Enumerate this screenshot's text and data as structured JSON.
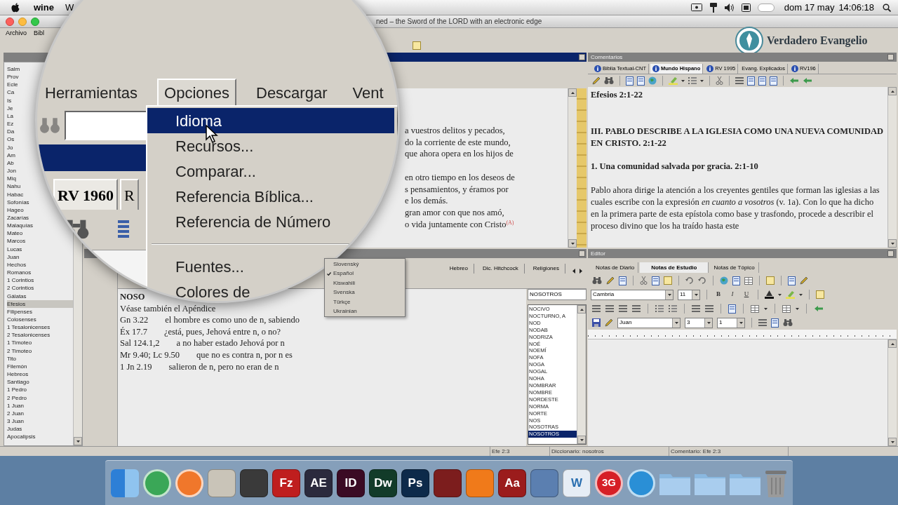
{
  "menubar": {
    "app": "wine",
    "menu_fragment": "W",
    "date": "dom 17 may",
    "time": "14:06:18"
  },
  "window": {
    "title": "ned – the Sword of the LORD with an electronic edge",
    "menu": [
      "Archivo",
      "Bibl"
    ],
    "logo": "Verdadero Evangelio"
  },
  "books": [
    {
      "label": "Salm",
      "selected": false
    },
    {
      "label": "Prov",
      "selected": false
    },
    {
      "label": "Ecle",
      "selected": false
    },
    {
      "label": "Ca",
      "selected": false
    },
    {
      "label": "Is",
      "selected": false
    },
    {
      "label": "Je",
      "selected": false
    },
    {
      "label": "La",
      "selected": false
    },
    {
      "label": "Ez",
      "selected": false
    },
    {
      "label": "Da",
      "selected": false
    },
    {
      "label": "Os",
      "selected": false
    },
    {
      "label": "Jo",
      "selected": false
    },
    {
      "label": "Am",
      "selected": false
    },
    {
      "label": "Ab",
      "selected": false
    },
    {
      "label": "Jon",
      "selected": false
    },
    {
      "label": "Miq",
      "selected": false
    },
    {
      "label": "Nahu",
      "selected": false
    },
    {
      "label": "Habac",
      "selected": false
    },
    {
      "label": "Sofonías",
      "selected": false
    },
    {
      "label": "Hageo",
      "selected": false
    },
    {
      "label": "Zacarías",
      "selected": false
    },
    {
      "label": "Malaquías",
      "selected": false
    },
    {
      "label": "Mateo",
      "selected": false
    },
    {
      "label": "Marcos",
      "selected": false
    },
    {
      "label": "Lucas",
      "selected": false
    },
    {
      "label": "Juan",
      "selected": false
    },
    {
      "label": "Hechos",
      "selected": false
    },
    {
      "label": "Romanos",
      "selected": false
    },
    {
      "label": "1 Corintios",
      "selected": false
    },
    {
      "label": "2 Corintios",
      "selected": false
    },
    {
      "label": "Gálatas",
      "selected": false
    },
    {
      "label": "Efesios",
      "selected": true
    },
    {
      "label": "Filipenses",
      "selected": false
    },
    {
      "label": "Colosenses",
      "selected": false
    },
    {
      "label": "1 Tesalonicenses",
      "selected": false
    },
    {
      "label": "2 Tesalonicenses",
      "selected": false
    },
    {
      "label": "1 Timoteo",
      "selected": false
    },
    {
      "label": "2 Timoteo",
      "selected": false
    },
    {
      "label": "Tito",
      "selected": false
    },
    {
      "label": "Filemón",
      "selected": false
    },
    {
      "label": "Hebreos",
      "selected": false
    },
    {
      "label": "Santiago",
      "selected": false
    },
    {
      "label": "1 Pedro",
      "selected": false
    },
    {
      "label": "2 Pedro",
      "selected": false
    },
    {
      "label": "1 Juan",
      "selected": false
    },
    {
      "label": "2 Juan",
      "selected": false
    },
    {
      "label": "3 Juan",
      "selected": false
    },
    {
      "label": "Judas",
      "selected": false
    },
    {
      "label": "Apocalipsis",
      "selected": false
    }
  ],
  "bible_panel": {
    "paragraphs": [
      [
        "a vuestros delitos y pecados,",
        "do la corriente de este mundo,",
        "que ahora opera en los hijos de"
      ],
      [
        "en otro tiempo en los deseos de",
        "s pensamientos, y éramos por",
        "e los demás.",
        "gran amor con que nos amó,",
        "o vida juntamente con Cristo$^{(A)}$"
      ]
    ]
  },
  "dictionary": {
    "tabs": [
      {
        "label": "Hebreo",
        "selected": false
      },
      {
        "label": "Dic. Hitchcock",
        "selected": false
      },
      {
        "label": "Religiones",
        "selected": false
      }
    ],
    "heading": "NOSO",
    "see_also": "Véase también el Apéndice",
    "entries": [
      {
        "ref": "Gn 3.22",
        "text": "el hombre es como uno de n, sabiendo"
      },
      {
        "ref": "Éx 17.7",
        "text": "¿está, pues, Jehová entre n, o no?"
      },
      {
        "ref": "Sal 124.1,2",
        "text": "a no haber estado Jehová por n"
      },
      {
        "ref": "Mr 9.40; Lc 9.50",
        "text": "que no es contra n, por n es"
      },
      {
        "ref": "1 Jn 2.19",
        "text": "salieron de n, pero no eran de n"
      }
    ],
    "search": "NOSOTROS",
    "words": [
      {
        "label": "NOCIVO",
        "selected": false
      },
      {
        "label": "NOCTURNO, A",
        "selected": false
      },
      {
        "label": "NOD",
        "selected": false
      },
      {
        "label": "NODAB",
        "selected": false
      },
      {
        "label": "NODRIZA",
        "selected": false
      },
      {
        "label": "NOÉ",
        "selected": false
      },
      {
        "label": "NOEMÍ",
        "selected": false
      },
      {
        "label": "NOFA",
        "selected": false
      },
      {
        "label": "NOGA",
        "selected": false
      },
      {
        "label": "NOGAL",
        "selected": false
      },
      {
        "label": "NOHA",
        "selected": false
      },
      {
        "label": "NOMBRAR",
        "selected": false
      },
      {
        "label": "NOMBRE",
        "selected": false
      },
      {
        "label": "NORDESTE",
        "selected": false
      },
      {
        "label": "NORMA",
        "selected": false
      },
      {
        "label": "NORTE",
        "selected": false
      },
      {
        "label": "NOS",
        "selected": false
      },
      {
        "label": "NOSOTRAS",
        "selected": false
      },
      {
        "label": "NOSOTROS",
        "selected": true
      }
    ]
  },
  "commentary": {
    "header": "Comentarios",
    "tabs": [
      {
        "label": "Biblia Textual-CNT",
        "icon": true,
        "selected": false
      },
      {
        "label": "Mundo Hispano",
        "icon": true,
        "selected": true
      },
      {
        "label": "RV 1995",
        "icon": true,
        "selected": false
      },
      {
        "label": "Evang. Explicados",
        "icon": false,
        "selected": false
      },
      {
        "label": "RV196",
        "icon": true,
        "selected": false
      }
    ],
    "title": "Efesios 2:1-22",
    "heading": "III. PABLO DESCRIBE A LA IGLESIA COMO UNA NUEVA COMUNIDAD EN CRISTO. 2:1-22",
    "subheading": "1. Una comunidad salvada por gracia. 2:1-10",
    "paragraph": "Pablo ahora dirige la atención a los creyentes gentiles que forman las iglesias a las cuales escribe con la expresión *en cuanto a vosotros* (v. 1a). Con lo que ha dicho en la primera parte de esta epístola como base y trasfondo, procede a describir el proceso divino que los ha traído hasta este"
  },
  "editor": {
    "header": "Editor",
    "tabs": [
      {
        "label": "Notas de Diario",
        "selected": false
      },
      {
        "label": "Notas de Estudio",
        "selected": true
      },
      {
        "label": "Notas de Tópico",
        "selected": false
      }
    ],
    "font": "Cambria",
    "size": "11",
    "format_buttons": [
      "B",
      "I",
      "U"
    ],
    "style": "Juan",
    "field_2": "3",
    "field_3": "1"
  },
  "status_bar": [
    "Efe 2:3",
    "Diccionario: nosotros",
    "Comentario: Efe 2:3"
  ],
  "magnifier": {
    "menus": [
      {
        "label": "Herramientas",
        "selected": false
      },
      {
        "label": "Opciones",
        "selected": true
      },
      {
        "label": "Descargar",
        "selected": false
      },
      {
        "label": "Vent",
        "selected": false
      }
    ],
    "tabs": [
      {
        "label": "RV 1960",
        "selected": true
      },
      {
        "label": "R",
        "selected": false
      }
    ],
    "items": [
      {
        "kind": "item",
        "label": "Idioma",
        "selected": true
      },
      {
        "kind": "item",
        "label": "Recursos...",
        "selected": false
      },
      {
        "kind": "item",
        "label": "Comparar...",
        "selected": false
      },
      {
        "kind": "item",
        "label": "Referencia Bíblica...",
        "selected": false
      },
      {
        "kind": "item",
        "label": "Referencia de Número",
        "selected": false
      },
      {
        "kind": "separator"
      },
      {
        "kind": "item",
        "label": "Fuentes...",
        "selected": false
      },
      {
        "kind": "item",
        "label": "Colores de",
        "selected": false
      }
    ]
  },
  "language_menu": [
    {
      "label": "Slovenský",
      "checked": false
    },
    {
      "label": "Español",
      "checked": true
    },
    {
      "label": "Kiswahili",
      "checked": false
    },
    {
      "label": "Svenska",
      "checked": false
    },
    {
      "label": "Türkçe",
      "checked": false
    },
    {
      "label": "Ukrainian",
      "checked": false
    }
  ],
  "dock": [
    {
      "kind": "finder"
    },
    {
      "kind": "round",
      "color": "#3aa757"
    },
    {
      "kind": "round",
      "color": "#f0772b"
    },
    {
      "kind": "app",
      "color": "#c9c4b8"
    },
    {
      "kind": "app",
      "color": "#3a3a3a"
    },
    {
      "kind": "app",
      "color": "#bf1e1e",
      "label": "Fz"
    },
    {
      "kind": "app",
      "color": "#2b2a3d",
      "label": "AE"
    },
    {
      "kind": "app",
      "color": "#3b0b24",
      "label": "ID"
    },
    {
      "kind": "app",
      "color": "#123b29",
      "label": "Dw"
    },
    {
      "kind": "app",
      "color": "#0d2a4a",
      "label": "Ps"
    },
    {
      "kind": "app",
      "color": "#7c1d1d"
    },
    {
      "kind": "app",
      "color": "#f07a1a"
    },
    {
      "kind": "app",
      "color": "#9b1c1c",
      "label": "Aa"
    },
    {
      "kind": "app",
      "color": "#5b7fb0"
    },
    {
      "kind": "app",
      "color": "#e6edf5",
      "label": "W"
    },
    {
      "kind": "round",
      "color": "#d61f26",
      "label": "3G"
    },
    {
      "kind": "round",
      "color": "#2a8fd6"
    },
    {
      "kind": "folder"
    },
    {
      "kind": "folder"
    },
    {
      "kind": "folder"
    },
    {
      "kind": "trash"
    }
  ]
}
